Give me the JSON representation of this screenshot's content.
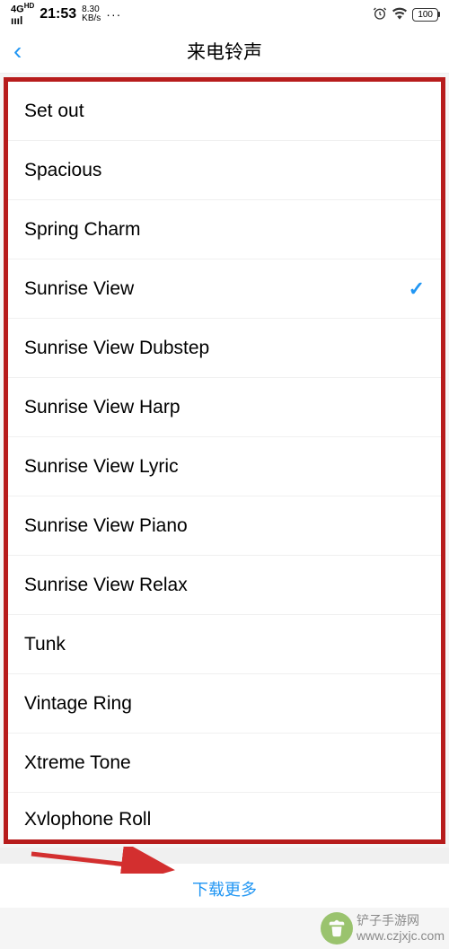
{
  "status": {
    "signal": "4G",
    "hd": "HD",
    "time": "21:53",
    "speed_num": "8.30",
    "speed_unit": "KB/s",
    "dots": "···",
    "alarm": "⏰",
    "wifi": "📶",
    "battery": "100"
  },
  "header": {
    "back": "‹",
    "title": "来电铃声"
  },
  "ringtones": [
    {
      "name": "Set out",
      "selected": false
    },
    {
      "name": "Spacious",
      "selected": false
    },
    {
      "name": "Spring Charm",
      "selected": false
    },
    {
      "name": "Sunrise View",
      "selected": true
    },
    {
      "name": "Sunrise View Dubstep",
      "selected": false
    },
    {
      "name": "Sunrise View Harp",
      "selected": false
    },
    {
      "name": "Sunrise View Lyric",
      "selected": false
    },
    {
      "name": "Sunrise View Piano",
      "selected": false
    },
    {
      "name": "Sunrise View Relax",
      "selected": false
    },
    {
      "name": "Tunk",
      "selected": false
    },
    {
      "name": "Vintage Ring",
      "selected": false
    },
    {
      "name": "Xtreme Tone",
      "selected": false
    },
    {
      "name": "Xvlophone Roll",
      "selected": false
    }
  ],
  "footer": {
    "download_more": "下载更多"
  },
  "watermark": {
    "icon": "🔨",
    "line1": "铲子手游网",
    "line2": "www.czjxjc.com"
  }
}
